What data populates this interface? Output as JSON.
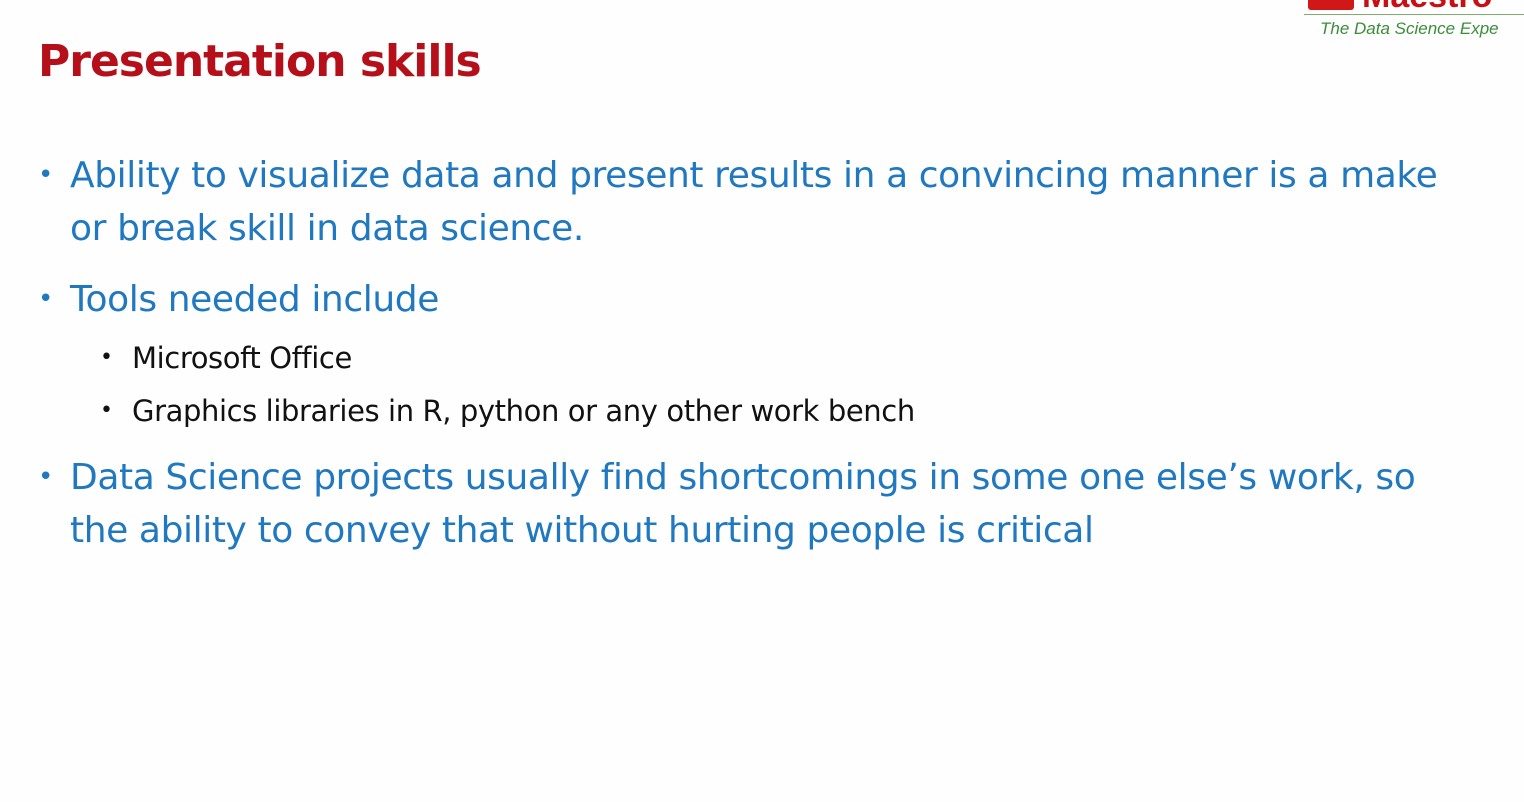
{
  "logo": {
    "name": "Maestro",
    "tagline": "The Data Science Expe"
  },
  "slide": {
    "title": "Presentation skills",
    "bullets": [
      {
        "text": "Ability to visualize data and present results in a convincing manner is a make or break skill in data science."
      },
      {
        "text": "Tools needed include",
        "sub_bullets": [
          "Microsoft Office",
          "Graphics libraries in R, python or any other work bench"
        ]
      },
      {
        "text": "Data Science projects usually find shortcomings in some one else’s work, so the ability to convey that without hurting people is critical"
      }
    ],
    "bullet_glyph": "•"
  },
  "colors": {
    "title": "#b5101a",
    "bullet_text": "#1f78c0",
    "sub_bullet_text": "#111111",
    "logo_red": "#c80f14",
    "logo_tagline": "#3b8d3a"
  }
}
